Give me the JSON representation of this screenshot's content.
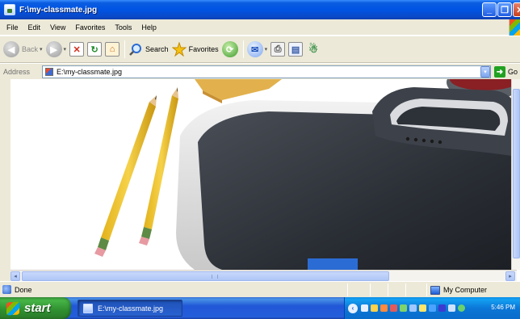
{
  "window": {
    "title": "F:\\my-classmate.jpg",
    "min_glyph": "_",
    "max_glyph": "❐",
    "close_glyph": "✕"
  },
  "menu": {
    "items": [
      "File",
      "Edit",
      "View",
      "Favorites",
      "Tools",
      "Help"
    ]
  },
  "toolbar": {
    "back_label": "Back",
    "search_label": "Search",
    "favorites_label": "Favorites",
    "dropdown_glyph": "▾"
  },
  "address": {
    "label": "Address",
    "value": "E:\\my-classmate.jpg",
    "go_label": "Go",
    "go_glyph": "➜",
    "drop_glyph": "▾"
  },
  "scroll": {
    "left_glyph": "◂",
    "right_glyph": "▸"
  },
  "status": {
    "text": "Done",
    "zone_label": "My Computer"
  },
  "taskbar": {
    "start_label": "start",
    "task_label": "E:\\my-classmate.jpg",
    "tray_chevron": "‹",
    "clock": "5:46 PM"
  },
  "colors": {
    "titlebar": "#0054e3",
    "chrome": "#ece9d8",
    "taskbar": "#245edb",
    "start": "#2f8f2f",
    "tray": "#0b77d7"
  }
}
